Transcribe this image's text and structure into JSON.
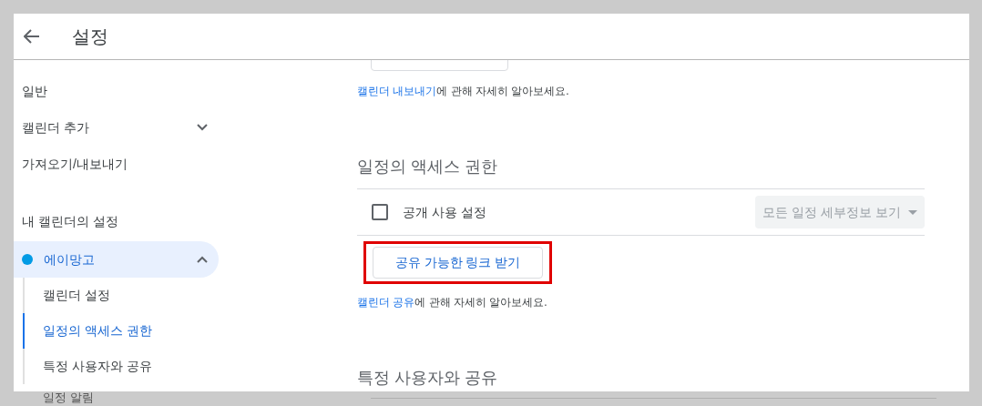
{
  "header": {
    "title": "설정"
  },
  "sidebar": {
    "items": [
      {
        "kind": "item",
        "label": "일반"
      },
      {
        "kind": "expandable",
        "label": "캘린더 추가",
        "expanded": false
      },
      {
        "kind": "item",
        "label": "가져오기/내보내기"
      },
      {
        "kind": "heading",
        "label": "내 캘린더의 설정"
      },
      {
        "kind": "calendar",
        "label": "에이망고",
        "color": "#039be5",
        "expanded": true,
        "children": [
          {
            "label": "캘린더 설정",
            "selected": false
          },
          {
            "label": "일정의 액세스 권한",
            "selected": true
          },
          {
            "label": "특정 사용자와 공유",
            "selected": false
          },
          {
            "label": "일정 알림",
            "selected": false
          }
        ]
      }
    ]
  },
  "export_note": {
    "link": "캘린더 내보내기",
    "text": "에 관해 자세히 알아보세요."
  },
  "access": {
    "title": "일정의 액세스 권한",
    "public_checkbox": {
      "label": "공개 사용 설정",
      "checked": false
    },
    "detail_dropdown": {
      "value": "모든 일정 세부정보 보기",
      "disabled": true
    },
    "share_link_button": {
      "label": "공유 가능한 링크 받기",
      "highlighted": true
    },
    "note": {
      "link": "캘린더 공유",
      "text": "에 관해 자세히 알아보세요."
    }
  },
  "share_section": {
    "title": "특정 사용자와 공유"
  }
}
